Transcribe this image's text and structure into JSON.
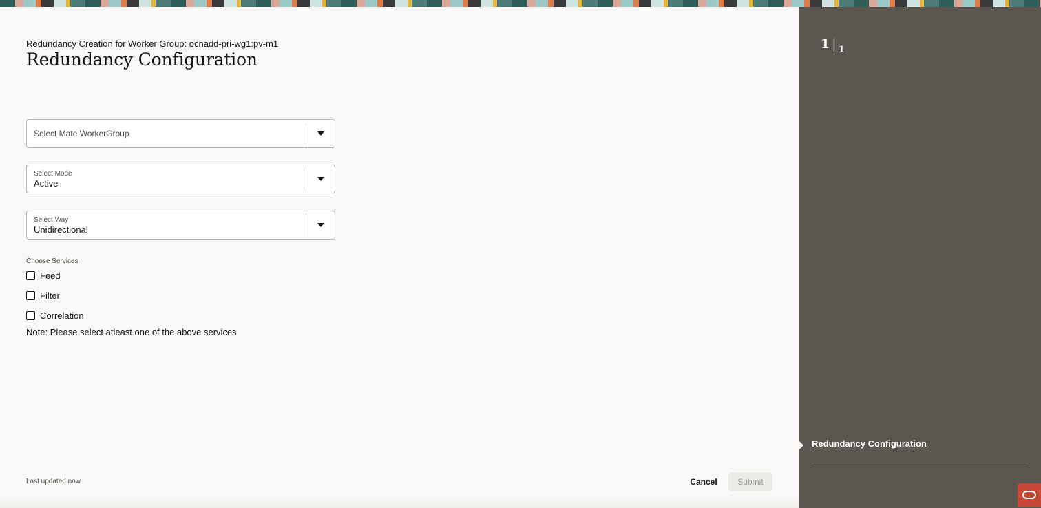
{
  "header": {
    "subtitle": "Redundancy Creation for Worker Group: ocnadd-pri-wg1:pv-m1",
    "title": "Redundancy Configuration"
  },
  "form": {
    "mate_workergroup": {
      "placeholder": "Select Mate WorkerGroup",
      "value": "",
      "icon": "chevron-down-icon"
    },
    "mode": {
      "label": "Select Mode",
      "value": "Active",
      "icon": "chevron-down-icon"
    },
    "way": {
      "label": "Select Way",
      "value": "Unidirectional",
      "icon": "chevron-down-icon"
    },
    "services": {
      "label": "Choose Services",
      "options": [
        {
          "label": "Feed",
          "checked": false
        },
        {
          "label": "Filter",
          "checked": false
        },
        {
          "label": "Correlation",
          "checked": false
        }
      ],
      "note": "Note: Please select atleast one of the above services"
    }
  },
  "footer": {
    "last_updated": "Last updated now",
    "cancel_label": "Cancel",
    "submit_label": "Submit"
  },
  "side_panel": {
    "current_step": "1",
    "total_steps": "1",
    "steps": [
      {
        "label": "Redundancy Configuration",
        "active": true
      }
    ],
    "badge_icon": "oracle-logo-icon"
  },
  "colors": {
    "side_panel_bg": "#5c5650",
    "main_bg": "#f9f8f6",
    "badge_bg": "#c74634"
  }
}
